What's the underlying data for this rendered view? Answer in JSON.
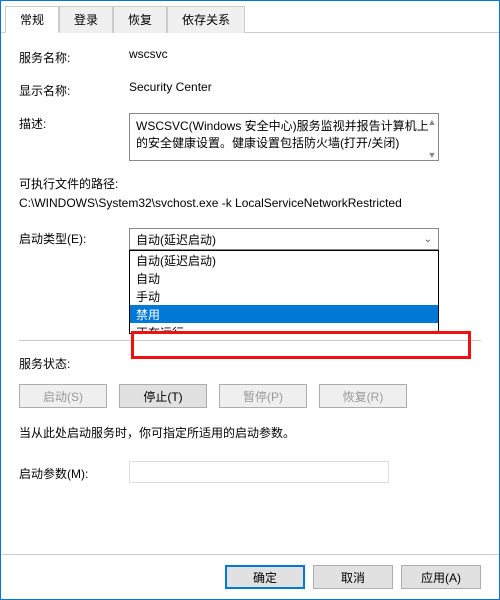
{
  "tabs": {
    "general": "常规",
    "logon": "登录",
    "recovery": "恢复",
    "dependencies": "依存关系"
  },
  "fields": {
    "service_name_label": "服务名称:",
    "service_name_value": "wscsvc",
    "display_name_label": "显示名称:",
    "display_name_value": "Security Center",
    "description_label": "描述:",
    "description_value": "WSCSVC(Windows 安全中心)服务监视并报告计算机上的安全健康设置。健康设置包括防火墙(打开/关闭)",
    "exe_path_label": "可执行文件的路径:",
    "exe_path_value": "C:\\WINDOWS\\System32\\svchost.exe -k LocalServiceNetworkRestricted",
    "startup_type_label": "启动类型(E):",
    "startup_type_selected": "自动(延迟启动)",
    "startup_options": {
      "auto_delayed": "自动(延迟启动)",
      "auto": "自动",
      "manual": "手动",
      "disabled": "禁用",
      "truncated": "正在运行"
    },
    "status_label": "服务状态:",
    "start_btn": "启动(S)",
    "stop_btn": "停止(T)",
    "pause_btn": "暂停(P)",
    "resume_btn": "恢复(R)",
    "hint": "当从此处启动服务时，你可指定所适用的启动参数。",
    "start_params_label": "启动参数(M):"
  },
  "footer": {
    "ok": "确定",
    "cancel": "取消",
    "apply": "应用(A)"
  }
}
